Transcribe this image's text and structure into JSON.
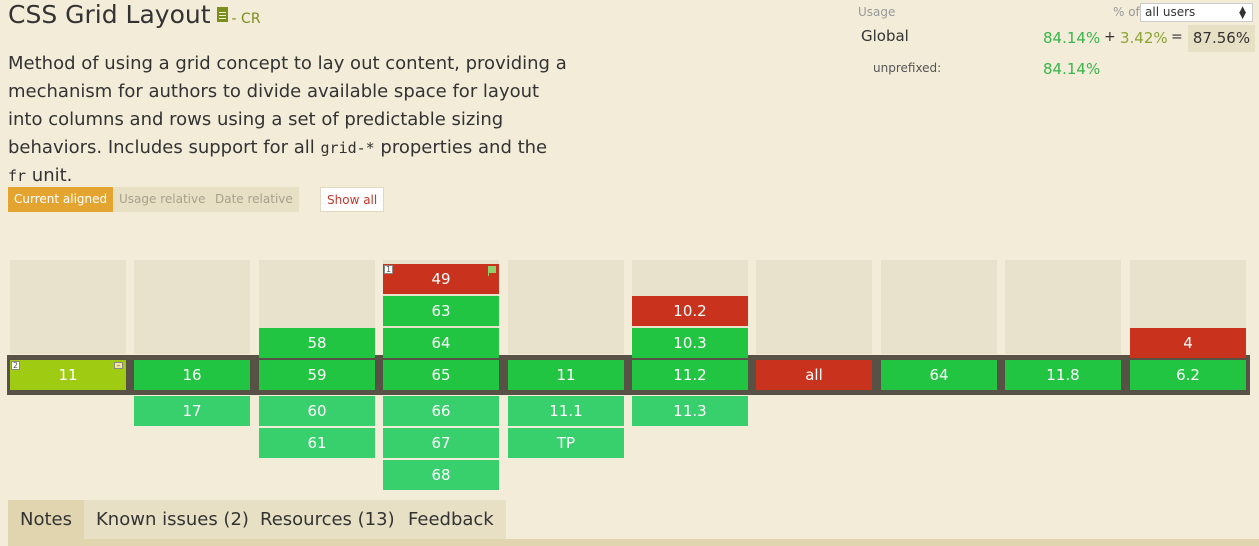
{
  "feature": {
    "title": "CSS Grid Layout",
    "status": "- CR",
    "description_parts": [
      "Method of using a grid concept to lay out content, providing a mechanism for authors to divide available space for layout into columns and rows using a set of predictable sizing behaviors. Includes support for all ",
      "grid-*",
      " properties and the ",
      "fr",
      " unit."
    ]
  },
  "usage": {
    "label": "Usage",
    "pct_of_label": "% of",
    "users_select": "all users",
    "global_label": "Global",
    "global_full": "84.14%",
    "plus": "+",
    "global_partial": "3.42%",
    "equals": "=",
    "global_total": "87.56%",
    "unprefixed_label": "unprefixed:",
    "unprefixed_value": "84.14%"
  },
  "view_buttons": {
    "current": "Current aligned",
    "usage": "Usage relative",
    "date": "Date relative",
    "show_all": "Show all"
  },
  "colors": {
    "supported": "#21c542",
    "supported_future": "#37d06c",
    "unsupported": "#c9321c",
    "partial": "#9fcc12",
    "accent": "#e4a530"
  },
  "browsers": [
    {
      "name": "ie",
      "past": [],
      "current": {
        "v": "11",
        "s": "a",
        "note": "2",
        "partial_icon": "–"
      },
      "future": []
    },
    {
      "name": "edge",
      "past": [],
      "current": {
        "v": "16",
        "s": "y"
      },
      "future": [
        {
          "v": "17",
          "s": "yl"
        }
      ]
    },
    {
      "name": "firefox",
      "past": [
        {
          "v": "58",
          "s": "y"
        }
      ],
      "current": {
        "v": "59",
        "s": "y"
      },
      "future": [
        {
          "v": "60",
          "s": "yl"
        },
        {
          "v": "61",
          "s": "yl"
        }
      ]
    },
    {
      "name": "chrome",
      "past": [
        {
          "v": "49",
          "s": "n",
          "note": "1",
          "flag": true
        },
        {
          "v": "63",
          "s": "y"
        },
        {
          "v": "64",
          "s": "y"
        }
      ],
      "current": {
        "v": "65",
        "s": "y"
      },
      "future": [
        {
          "v": "66",
          "s": "yl"
        },
        {
          "v": "67",
          "s": "yl"
        },
        {
          "v": "68",
          "s": "yl"
        }
      ]
    },
    {
      "name": "safari",
      "past": [],
      "current": {
        "v": "11",
        "s": "y"
      },
      "future": [
        {
          "v": "11.1",
          "s": "yl"
        },
        {
          "v": "TP",
          "s": "yl"
        }
      ]
    },
    {
      "name": "ios-safari",
      "past": [
        {
          "v": "10.2",
          "s": "n"
        },
        {
          "v": "10.3",
          "s": "y"
        }
      ],
      "current": {
        "v": "11.2",
        "s": "y"
      },
      "future": [
        {
          "v": "11.3",
          "s": "yl"
        }
      ]
    },
    {
      "name": "opera-mini",
      "past": [],
      "current": {
        "v": "all",
        "s": "n"
      },
      "future": []
    },
    {
      "name": "chrome-android",
      "past": [],
      "current": {
        "v": "64",
        "s": "y"
      },
      "future": []
    },
    {
      "name": "uc-browser",
      "past": [],
      "current": {
        "v": "11.8",
        "s": "y"
      },
      "future": []
    },
    {
      "name": "samsung-internet",
      "past": [
        {
          "v": "4",
          "s": "n"
        }
      ],
      "current": {
        "v": "6.2",
        "s": "y"
      },
      "future": []
    }
  ],
  "tabs": [
    "Notes",
    "Known issues (2)",
    "Resources (13)",
    "Feedback"
  ]
}
